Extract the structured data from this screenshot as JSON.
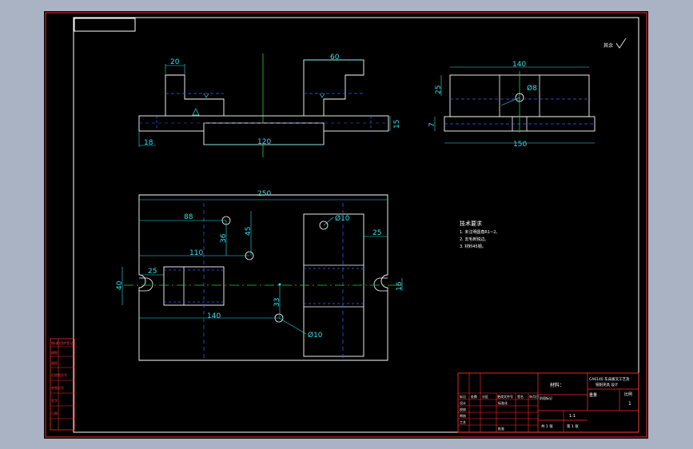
{
  "drawing": {
    "top_view": {
      "dims": {
        "left_width": "20",
        "right_width": "60",
        "plate_height": "15",
        "foot": "18",
        "center_len": "120"
      }
    },
    "side_view": {
      "dims": {
        "top_width": "140",
        "height": "25",
        "hole": "Ø8",
        "thick": "7",
        "bottom_width": "150"
      }
    },
    "plan_view": {
      "dims": {
        "overall": "250",
        "d88": "88",
        "d36": "36",
        "d45": "45",
        "d110": "110",
        "d25_left": "25",
        "d40": "40",
        "d140": "140",
        "d33": "33",
        "d25_right": "25",
        "d16": "16",
        "hole_top": "Ø10",
        "hole_bottom": "Ø10"
      }
    },
    "tech_req": {
      "title": "技术要求",
      "lines": [
        "1. 未注明圆角R1~2。",
        "2. 去毛刺锐边。",
        "3. 材料45钢。"
      ]
    },
    "roughness_note": "其余",
    "title_block": {
      "material_label": "材料：",
      "project_line1": "CA6140 车床拨叉工艺及",
      "project_line2": "铣削夹具 设计",
      "scale_label": "比例",
      "scale_value": "1",
      "ratio": "1:1",
      "weight_label": "重量",
      "sheet_text": "共 1 张",
      "page_text": "第 1 张",
      "stage_label": "阶段标记",
      "row_labels": [
        "设计",
        "校核",
        "审核",
        "工艺"
      ],
      "header_labels": [
        "标记",
        "处数",
        "分区",
        "更改文件号",
        "签名",
        "年月日"
      ],
      "std_label": "标准化",
      "approve_label": "批准"
    },
    "side_strip": [
      "借(通)用件登记",
      "描图",
      "描校",
      "旧底图总号",
      "底图总号",
      "签字",
      "日期"
    ]
  },
  "colors": {
    "background": "#000000",
    "frame": "#ff2a2a",
    "outline": "#ffffff",
    "dimension": "#2ee0e6",
    "centerline": "#22d13a",
    "hidden": "#3d62ff"
  }
}
